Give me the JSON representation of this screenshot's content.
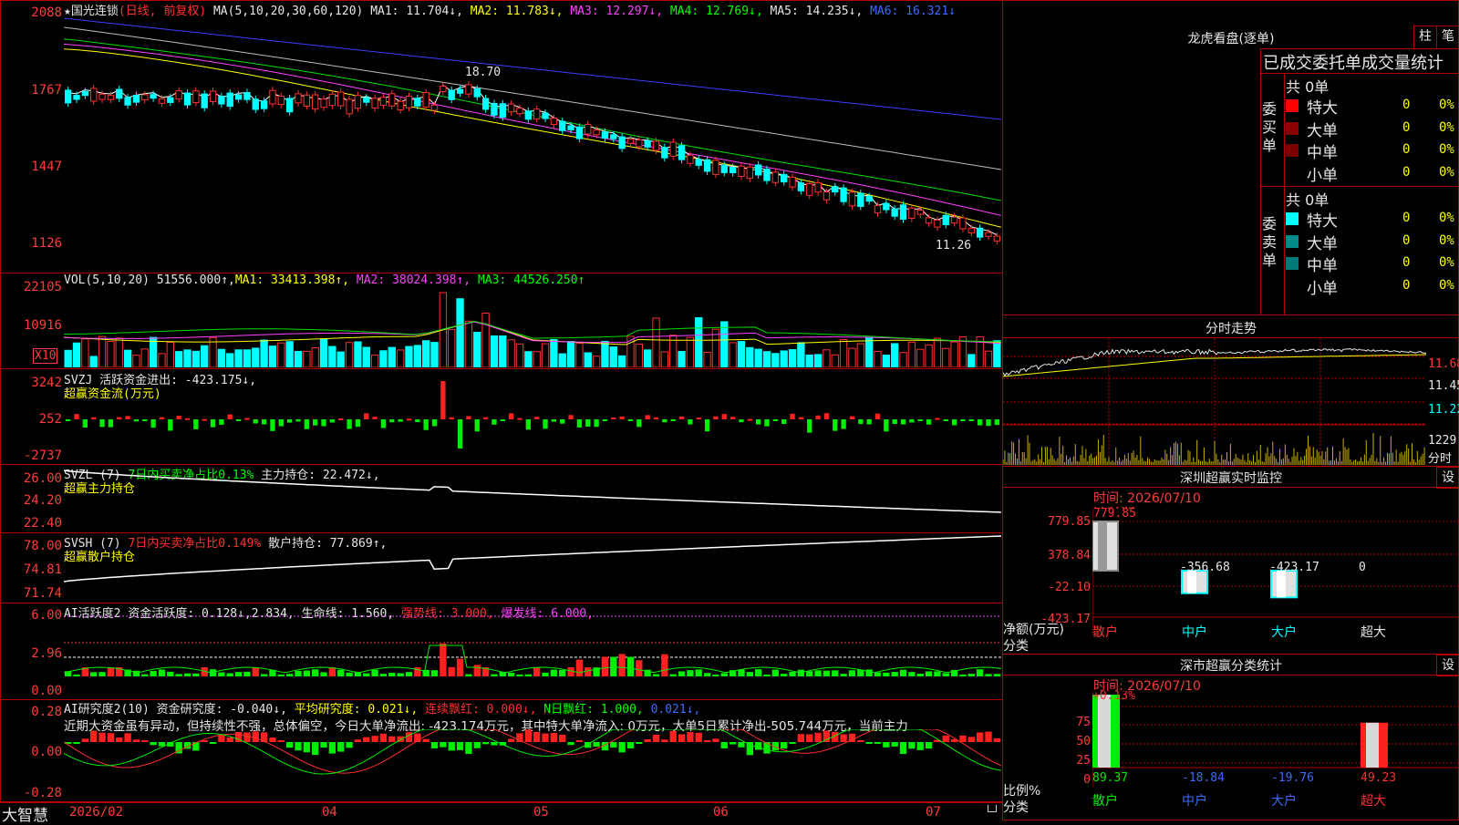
{
  "main_chart": {
    "header": {
      "star": "★",
      "name": "国光连锁",
      "mode": "(日线, 前复权)",
      "ma_def": "MA(5,10,20,30,60,120)",
      "ma1": "MA1: 11.704↓,",
      "ma2": "MA2: 11.783↓,",
      "ma3": "MA3: 12.297↓,",
      "ma4": "MA4: 12.769↓,",
      "ma5": "MA5: 14.235↓,",
      "ma6": "MA6: 16.321↓"
    },
    "y_labels": [
      "2088",
      "1767",
      "1447",
      "1126"
    ],
    "high_label": "18.70",
    "low_label": "11.26"
  },
  "vol_pane": {
    "header": {
      "def": "VOL(5,10,20)",
      "vol": "51556.000↑,",
      "ma1": "MA1: 33413.398↑,",
      "ma2": "MA2: 38024.398↑,",
      "ma3": "MA3: 44526.250↑"
    },
    "y_labels": [
      "22105",
      "10916"
    ],
    "unit": "X10"
  },
  "svzj_pane": {
    "header": {
      "def": "SVZJ",
      "label": "活跃资金进出: -423.175↓,",
      "sub": "超赢资金流(万元)"
    },
    "y_labels": [
      "3242",
      "252",
      "-2737"
    ]
  },
  "svzl_pane": {
    "header": {
      "def": "SVZL (7)",
      "ratio": "7日内买卖净占比0.13%",
      "hold": "主力持仓: 22.472↓,",
      "sub": "超赢主力持仓"
    },
    "y_labels": [
      "26.00",
      "24.20",
      "22.40"
    ]
  },
  "svsh_pane": {
    "header": {
      "def": "SVSH (7)",
      "ratio": "7日内买卖净占比0.149%",
      "hold": "散户持仓: 77.869↑,",
      "sub": "超赢散户持仓"
    },
    "y_labels": [
      "78.00",
      "74.81",
      "71.74"
    ]
  },
  "ai_active": {
    "header": {
      "def": "AI活跃度2",
      "a": "资金活跃度: 0.128↓,",
      "b": "2.834,",
      "c": "生命线: 1.560,",
      "d": "强势线: 3.000,",
      "e": "爆发线: 6.000,"
    },
    "y_labels": [
      "6.00",
      "2.96",
      "0.00"
    ]
  },
  "ai_research": {
    "header": {
      "def": "AI研究度2(10)",
      "a": "资金研究度: -0.040↓,",
      "b": "平均研究度: 0.021↓,",
      "c": "连续飘红: 0.000↓,",
      "d": "N日飘红: 1.000,",
      "e": "0.021↓,"
    },
    "commentary": "近期大资金虽有异动，但持续性不强，总体偏空，今日大单净流出: -423.174万元，其中特大单净流入: 0万元，大单5日累计净出-505.744万元，当前主力",
    "y_labels": [
      "0.28",
      "0.00",
      "-0.28"
    ]
  },
  "x_axis": {
    "logo": "大智慧",
    "labels": [
      "2026/02",
      "04",
      "05",
      "06",
      "07"
    ]
  },
  "lhb": {
    "title": "龙虎看盘(逐单)",
    "btn1": "柱",
    "btn2": "笔",
    "subtitle": "已成交委托单成交量统计",
    "buy_label": "委买单",
    "sell_label": "委卖单",
    "buy_total": "共 0单",
    "sell_total": "共 0单",
    "buy_rows": [
      {
        "name": "特大",
        "qty": "0",
        "pct": "0%",
        "color": "#ff0000"
      },
      {
        "name": "大单",
        "qty": "0",
        "pct": "0%",
        "color": "#8b0000"
      },
      {
        "name": "中单",
        "qty": "0",
        "pct": "0%",
        "color": "#7a0000"
      },
      {
        "name": "小单",
        "qty": "0",
        "pct": "0%",
        "color": "#000000"
      }
    ],
    "sell_rows": [
      {
        "name": "特大",
        "qty": "0",
        "pct": "0%",
        "color": "#00ffff"
      },
      {
        "name": "大单",
        "qty": "0",
        "pct": "0%",
        "color": "#008b8b"
      },
      {
        "name": "中单",
        "qty": "0",
        "pct": "0%",
        "color": "#007a7a"
      },
      {
        "name": "小单",
        "qty": "0",
        "pct": "0%",
        "color": "#000000"
      }
    ]
  },
  "intraday": {
    "title": "分时走势",
    "y_labels": [
      "11.68",
      "11.45",
      "11.22"
    ],
    "vol_label": "1229",
    "vol_unit": "分时"
  },
  "sz_monitor": {
    "title": "深圳超赢实时监控",
    "btn": "设",
    "time": "时间: 2026/07/10",
    "y_labels": [
      "779.85",
      "378.84",
      "-22.10",
      "-423.17"
    ],
    "top_value": "779.85",
    "y_unit": "净额(万元)",
    "y_unit2": "分类",
    "categories": [
      "散户",
      "中户",
      "大户",
      "超大"
    ],
    "values": [
      "779.85",
      "-356.68",
      "-423.17",
      "0"
    ]
  },
  "sz_class": {
    "title": "深市超赢分类统计",
    "btn": "设",
    "time": "时间: 2026/07/10",
    "top_value": "+0.13%",
    "y_labels": [
      "75",
      "50",
      "25",
      "0"
    ],
    "y_unit": "比例%",
    "y_unit2": "分类",
    "categories": [
      "散户",
      "中户",
      "大户",
      "超大"
    ],
    "values": [
      "89.37",
      "-18.84",
      "-19.76",
      "49.23"
    ]
  }
}
